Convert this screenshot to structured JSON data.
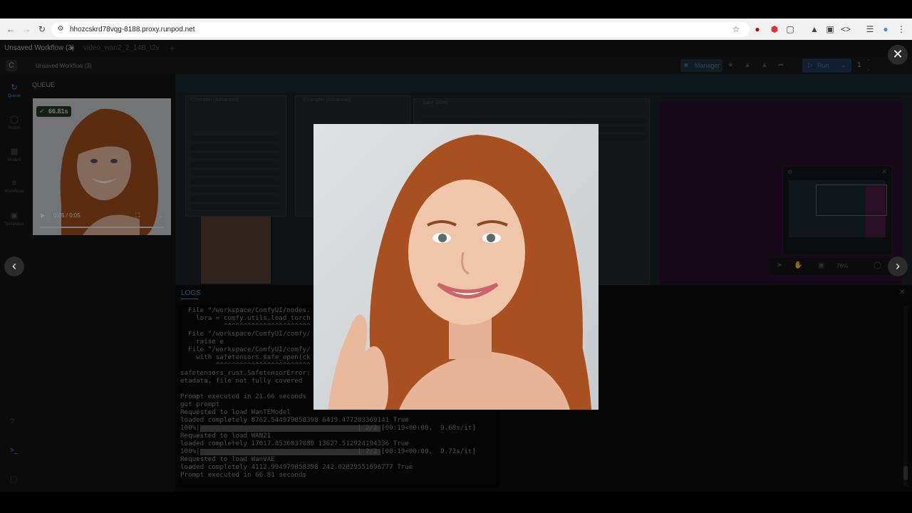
{
  "browser": {
    "url": "hhozcskrd78vqg-8188.proxy.runpod.net"
  },
  "workflow_tabs": [
    {
      "label": "Unsaved Workflow (3)",
      "active": true
    },
    {
      "label": "video_wan2_2_14B_t2v",
      "active": false
    }
  ],
  "toolbar": {
    "workflow_name": "Unsaved Workflow (3)",
    "manager_label": "Manager",
    "run_label": "Run",
    "batch_count": "1"
  },
  "sidebar": {
    "items": [
      {
        "label": "Queue",
        "icon": "history-icon"
      },
      {
        "label": "Nodes",
        "icon": "nodes-icon"
      },
      {
        "label": "Models",
        "icon": "models-icon"
      },
      {
        "label": "Workflows",
        "icon": "workflows-icon"
      },
      {
        "label": "Templates",
        "icon": "templates-icon"
      }
    ]
  },
  "queue": {
    "title": "QUEUE",
    "job_time": "66.81s",
    "video_time": "0:05 / 0:05"
  },
  "canvas": {
    "nodes": [
      {
        "title": "KSampler (Advanced)"
      },
      {
        "title": "KSampler (Advanced)"
      },
      {
        "title": "Save Video"
      }
    ],
    "zoom": "76%"
  },
  "logs": {
    "tab_label": "LOGS",
    "lines": [
      "  File \"/workspace/ComfyUI/nodes.",
      "    lora = comfy.utils.load_torch",
      "           ^^^^^^^^^^^^^^^^^^^^^^",
      "  File \"/workspace/ComfyUI/comfy/",
      "    raise e",
      "  File \"/workspace/ComfyUI/comfy/",
      "    with safetensors.safe_open(ck",
      "         ^^^^^^^^^^^^^^^^^^^^^^^^",
      "safetensors_rust.SafetensorError:",
      "etadata, file not fully covered",
      "",
      "Prompt executed in 21.66 seconds",
      "got prompt",
      "Requested to load WanTEModel",
      "loaded completely 8762.544979858398 6419.477203369141 True",
      "100%|                                        | 2/2 [00:19<00:00,  9.68s/it]",
      "Requested to load WAN21",
      "loaded completely 17017.8536037088 13627.512924194336 True",
      "100%|                                        | 2/2 [00:19<00:00,  9.72s/it]",
      "Requested to load WanVAE",
      "loaded completely 4112.994979858398 242.02829551696777 True",
      "Prompt executed in 66.81 seconds"
    ],
    "progress": [
      1.0,
      1.0
    ]
  }
}
